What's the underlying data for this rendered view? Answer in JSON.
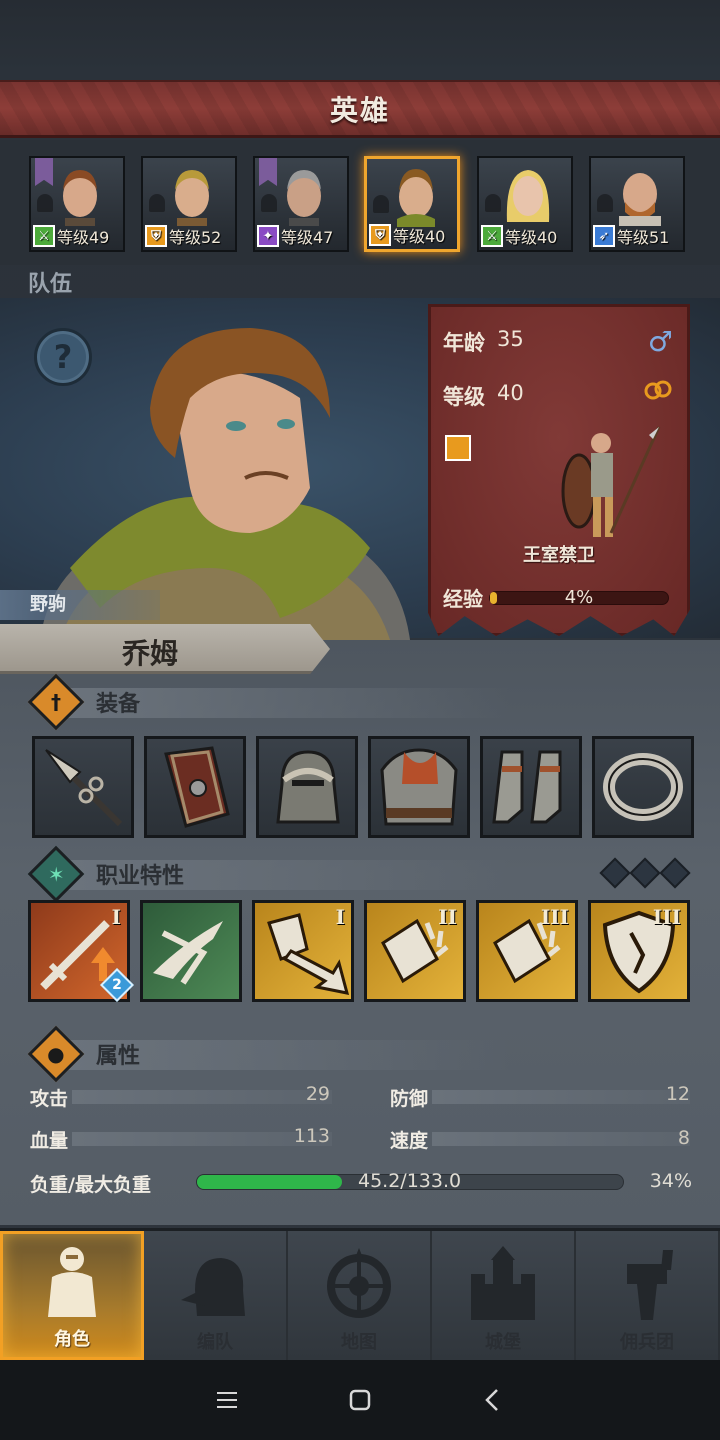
{
  "header": {
    "title": "英雄"
  },
  "heroes": [
    {
      "level_text": "等级49",
      "class": "green",
      "class_glyph": "⚔",
      "has_banner": true,
      "selected": false,
      "hair": "#8a4a24"
    },
    {
      "level_text": "等级52",
      "class": "orange",
      "class_glyph": "⛨",
      "has_banner": false,
      "selected": false,
      "hair": "#b89a3a"
    },
    {
      "level_text": "等级47",
      "class": "purple",
      "class_glyph": "✦",
      "has_banner": true,
      "selected": false,
      "hair": "#9a9a9a"
    },
    {
      "level_text": "等级40",
      "class": "orange",
      "class_glyph": "⛨",
      "has_banner": false,
      "selected": true,
      "hair": "#8a5a22"
    },
    {
      "level_text": "等级40",
      "class": "green",
      "class_glyph": "⚔",
      "has_banner": false,
      "selected": false,
      "hair": "#e8cc6a"
    },
    {
      "level_text": "等级51",
      "class": "blue",
      "class_glyph": "➶",
      "has_banner": false,
      "selected": false,
      "hair": "#b0672e"
    }
  ],
  "team": {
    "label": "队伍",
    "nickname": "野驹",
    "help_glyph": "?"
  },
  "info": {
    "age_label": "年龄",
    "age": "35",
    "level_label": "等级",
    "level": "40",
    "gender_glyph": "♂",
    "class_name": "王室禁卫",
    "exp_label": "经验",
    "exp_text": "4%",
    "exp_fraction": 0.04
  },
  "hero_name": "乔姆",
  "equipment": {
    "title": "装备",
    "icon_glyph": "†",
    "slots": [
      "spear",
      "shield",
      "helmet",
      "armor",
      "boots",
      "ring"
    ]
  },
  "traits": {
    "title": "职业特性",
    "icon_glyph": "✶",
    "skills": [
      {
        "color": "red",
        "roman": "I",
        "badge": "2"
      },
      {
        "color": "green",
        "roman": "",
        "badge": ""
      },
      {
        "color": "gold",
        "roman": "I",
        "badge": ""
      },
      {
        "color": "gold",
        "roman": "II",
        "badge": ""
      },
      {
        "color": "gold",
        "roman": "III",
        "badge": ""
      },
      {
        "color": "gold",
        "roman": "III",
        "badge": ""
      }
    ]
  },
  "attributes": {
    "title": "属性",
    "icon_glyph": "●",
    "attack_label": "攻击",
    "attack": "29",
    "defense_label": "防御",
    "defense": "12",
    "hp_label": "血量",
    "hp": "113",
    "speed_label": "速度",
    "speed": "8",
    "load_label": "负重/最大负重",
    "load_text": "45.2/133.0",
    "load_pct": "34%",
    "load_fraction": 0.34
  },
  "nav": [
    {
      "label": "角色",
      "icon": "knight-icon",
      "active": true
    },
    {
      "label": "编队",
      "icon": "helmet-icon",
      "active": false
    },
    {
      "label": "地图",
      "icon": "compass-icon",
      "active": false
    },
    {
      "label": "城堡",
      "icon": "castle-icon",
      "active": false
    },
    {
      "label": "佣兵团",
      "icon": "banner-icon",
      "active": false
    }
  ],
  "colors": {
    "title_bar": "#8d3d38",
    "selected_border": "#f0a62e",
    "info_panel": "#7a2f2c",
    "load_fill": "#2fb64a",
    "exp_fill": "#e8b22e"
  }
}
